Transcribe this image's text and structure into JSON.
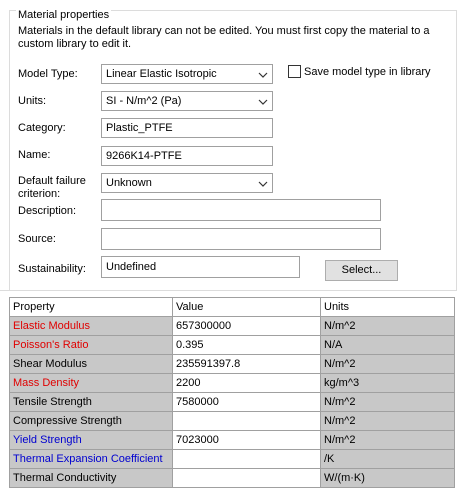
{
  "group": {
    "title": "Material properties",
    "note": "Materials in the default library can not be edited. You must first copy the material to a custom library to edit it."
  },
  "form": {
    "model_type": {
      "label": "Model Type:",
      "value": "Linear Elastic Isotropic"
    },
    "save_model_type": {
      "label": "Save model type in library",
      "checked": false
    },
    "units": {
      "label": "Units:",
      "value": "SI - N/m^2 (Pa)"
    },
    "category": {
      "label": "Category:",
      "value": "Plastic_PTFE"
    },
    "name": {
      "label": "Name:",
      "value": "9266K14-PTFE"
    },
    "default_failure": {
      "label_line1": "Default failure",
      "label_line2": "criterion:",
      "value": "Unknown"
    },
    "description": {
      "label": "Description:",
      "value": ""
    },
    "source": {
      "label": "Source:",
      "value": ""
    },
    "sustainability": {
      "label": "Sustainability:",
      "value": "Undefined",
      "button": "Select..."
    }
  },
  "table": {
    "headers": [
      "Property",
      "Value",
      "Units"
    ],
    "rows": [
      {
        "property": "Elastic Modulus",
        "value": "657300000",
        "units": "N/m^2",
        "color": "#e00000"
      },
      {
        "property": "Poisson's Ratio",
        "value": "0.395",
        "units": "N/A",
        "color": "#e00000"
      },
      {
        "property": "Shear Modulus",
        "value": "235591397.8",
        "units": "N/m^2",
        "color": "#000000"
      },
      {
        "property": "Mass Density",
        "value": "2200",
        "units": "kg/m^3",
        "color": "#e00000"
      },
      {
        "property": "Tensile Strength",
        "value": "7580000",
        "units": "N/m^2",
        "color": "#000000"
      },
      {
        "property": "Compressive Strength",
        "value": "",
        "units": "N/m^2",
        "color": "#000000"
      },
      {
        "property": "Yield Strength",
        "value": "7023000",
        "units": "N/m^2",
        "color": "#0000d0"
      },
      {
        "property": "Thermal Expansion Coefficient",
        "value": "",
        "units": "/K",
        "color": "#0000d0"
      },
      {
        "property": "Thermal Conductivity",
        "value": "",
        "units": "W/(m·K)",
        "color": "#000000"
      }
    ]
  }
}
